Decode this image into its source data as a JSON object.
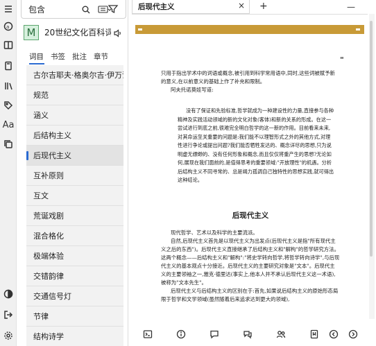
{
  "rail": {
    "aa_label": "Aa"
  },
  "search": {
    "value": "包含"
  },
  "dictionary": {
    "logo_letter": "M",
    "name": "20世纪文化百科词典"
  },
  "tabs": [
    {
      "label": "词目"
    },
    {
      "label": "书签"
    },
    {
      "label": "批注"
    },
    {
      "label": "章节"
    }
  ],
  "word_list": [
    {
      "label": "古尔吉耶夫·格奥尔吉·伊万诺维奇"
    },
    {
      "label": "规范"
    },
    {
      "label": "涵义"
    },
    {
      "label": "后结构主义"
    },
    {
      "label": "后现代主义",
      "selected": true
    },
    {
      "label": "互补原则"
    },
    {
      "label": "互文"
    },
    {
      "label": "荒诞戏剧"
    },
    {
      "label": "混合格化"
    },
    {
      "label": "极端体验"
    },
    {
      "label": "交错韵律"
    },
    {
      "label": "交通信号灯"
    },
    {
      "label": "节律"
    },
    {
      "label": "结构诗学"
    }
  ],
  "browser": {
    "tab_title": "后现代主义",
    "close": "×",
    "new_tab": "+",
    "minimize": "—"
  },
  "colors": {
    "band": "#c89a37",
    "accent": "#2a6ad1"
  },
  "reader": {
    "pause_label": "\"",
    "intro_1": "只用于指出学术中的词语或概念,被引用到科学常用语中,同时,这些词被赋予新的意义,在以前意义的基础上作了补充和限制。",
    "intro_2": "阿夫托诺莫娃写道:",
    "quote": "没有了保证和先验标准,哲学就成为一种建设性的力量,直接参与各种精神及实践活动领域的新的文化对象(客体)和新的关系的形成。在这一尝试进行到底之前,很难完全明白哲学的这一新的作用。目前看来未来,对其命运至关重要的问题是:我们能不以理智形式之外的其他方式,对理性进行争论或提出问题?我们能否牺牲发达的、概念详尽的思想,只为说明虚无缥缈的、没有任何形象和概念,而且仅仅将重产生的思想?无论如何,展现在我们面前的,是值得思考的重要领域:\"开放理性\"的机遇。分析后结构主义不同寻常的、总是竭力孤调自己独特性的思想实践,就可得出这种结论。",
    "heading": "后现代主义",
    "body_1": "现代哲学、艺术以及科学的主要流派。",
    "body_2": "自然,后现代主义首先是以现代主义为出发点(后现代主义是指\"所有现代主义之后的东西\")。后现代主义直接继承了后结构主义和\"解构\"的哲学研究方法。这两个概念——后结构主义和\"解构\":\"将史学转向哲学,将哲学转向诗学\",与后现代主义的基本观点十分接近。后现代主义的主要研究对象是\"文本\"。后现代主义的主要领袖之一,雅克·德里达(事实上,他本人并不承认后现代主义这一术语),被称为\"文本先生\"。",
    "body_3": "后现代主义与后结构主义的区别在于:首先,如果说后结构主义的原始形态局限于哲学和文学领域(虽然随着后来追求达到更大的领域),"
  }
}
